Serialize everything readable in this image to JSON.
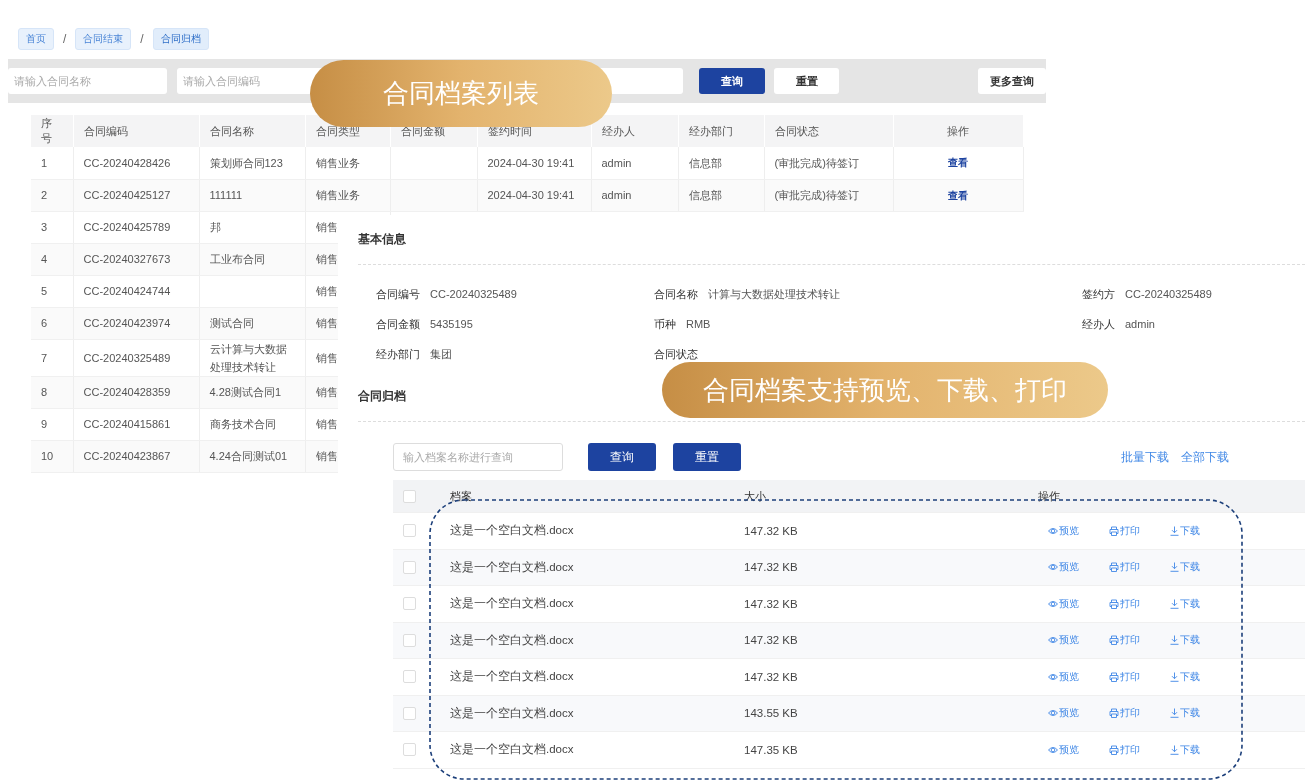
{
  "breadcrumb": [
    {
      "label": "首页",
      "selected": false
    },
    {
      "label": "合同结束",
      "selected": false
    },
    {
      "label": "合同归档",
      "selected": true
    }
  ],
  "breadcrumb_separator": "/",
  "filter": {
    "fields": [
      {
        "kind": "text",
        "placeholder": "请输入合同名称"
      },
      {
        "kind": "text",
        "placeholder": "请输入合同编码"
      },
      {
        "kind": "text"
      }
    ],
    "buttons": [
      {
        "label": "查询",
        "kind": "primary"
      },
      {
        "label": "重置",
        "kind": "default"
      },
      {
        "label": "更多查询",
        "kind": "more"
      }
    ]
  },
  "banners": [
    {
      "text": "合同档案列表"
    },
    {
      "text": "合同档案支持预览、下载、打印"
    }
  ],
  "list_table": {
    "columns": [
      "序号",
      "合同编码",
      "合同名称",
      "合同类型",
      "合同金额",
      "签约时间",
      "经办人",
      "经办部门",
      "合同状态",
      "操作"
    ],
    "rows": [
      {
        "cells": [
          "1",
          "CC-20240428426",
          "策划师合同123",
          "销售业务",
          "",
          "2024-04-30 19:41",
          "admin",
          "信息部",
          "(审批完成)待签订"
        ],
        "action": "查看"
      },
      {
        "cells": [
          "2",
          "CC-20240425127",
          "111111",
          "销售业务",
          "",
          "2024-04-30 19:41",
          "admin",
          "信息部",
          "(审批完成)待签订"
        ],
        "action": "查看"
      },
      {
        "cells": [
          "3",
          "CC-20240425789",
          "邦",
          "销售"
        ]
      },
      {
        "cells": [
          "4",
          "CC-20240327673",
          "工业布合同",
          "销售"
        ]
      },
      {
        "cells": [
          "5",
          "CC-20240424744",
          "",
          "销售"
        ]
      },
      {
        "cells": [
          "6",
          "CC-20240423974",
          "测试合同",
          "销售"
        ]
      },
      {
        "cells": [
          "7",
          "CC-20240325489",
          "云计算与大数据处理技术转让",
          "销售"
        ]
      },
      {
        "cells": [
          "8",
          "CC-20240428359",
          "4.28测试合同1",
          "销售"
        ]
      },
      {
        "cells": [
          "9",
          "CC-20240415861",
          "商务技术合同",
          "销售"
        ]
      },
      {
        "cells": [
          "10",
          "CC-20240423867",
          "4.24合同测试01",
          "销售"
        ]
      }
    ]
  },
  "detail": {
    "basic_title": "基本信息",
    "fields": [
      {
        "label": "合同编号",
        "value": "CC-20240325489"
      },
      {
        "label": "合同名称",
        "value": "计算与大数据处理技术转让"
      },
      {
        "label": "签约方",
        "value": "CC-20240325489"
      },
      {
        "label": "合同金额",
        "value": "5435195"
      },
      {
        "label": "币种",
        "value": "RMB"
      },
      {
        "label": "经办人",
        "value": "admin"
      },
      {
        "label": "经办部门",
        "value": "集团"
      },
      {
        "label": "合同状态"
      }
    ],
    "archive_title": "合同归档",
    "search": {
      "placeholder": "输入档案名称进行查询"
    },
    "buttons": [
      "查询",
      "重置"
    ],
    "links": [
      "批量下载",
      "全部下载"
    ],
    "columns": [
      "档案",
      "大小",
      "操作"
    ],
    "select_all_checked": false,
    "files": [
      {
        "name": "这是一个空白文档.docx",
        "size": "147.32 KB",
        "checked": false,
        "actions": [
          {
            "label": "预览",
            "kind": "preview"
          },
          {
            "label": "打印",
            "kind": "print"
          },
          {
            "label": "下载",
            "kind": "download"
          }
        ]
      },
      {
        "name": "这是一个空白文档.docx",
        "size": "147.32 KB",
        "checked": false,
        "actions": [
          {
            "label": "预览",
            "kind": "preview"
          },
          {
            "label": "打印",
            "kind": "print"
          },
          {
            "label": "下载",
            "kind": "download"
          }
        ]
      },
      {
        "name": "这是一个空白文档.docx",
        "size": "147.32 KB",
        "checked": false,
        "actions": [
          {
            "label": "预览",
            "kind": "preview"
          },
          {
            "label": "打印",
            "kind": "print"
          },
          {
            "label": "下载",
            "kind": "download"
          }
        ]
      },
      {
        "name": "这是一个空白文档.docx",
        "size": "147.32 KB",
        "checked": false,
        "actions": [
          {
            "label": "预览",
            "kind": "preview"
          },
          {
            "label": "打印",
            "kind": "print"
          },
          {
            "label": "下载",
            "kind": "download"
          }
        ]
      },
      {
        "name": "这是一个空白文档.docx",
        "size": "147.32 KB",
        "checked": false,
        "actions": [
          {
            "label": "预览",
            "kind": "preview"
          },
          {
            "label": "打印",
            "kind": "print"
          },
          {
            "label": "下载",
            "kind": "download"
          }
        ]
      },
      {
        "name": "这是一个空白文档.docx",
        "size": "143.55 KB",
        "checked": false,
        "actions": [
          {
            "label": "预览",
            "kind": "preview"
          },
          {
            "label": "打印",
            "kind": "print"
          },
          {
            "label": "下载",
            "kind": "download"
          }
        ]
      },
      {
        "name": "这是一个空白文档.docx",
        "size": "147.35 KB",
        "checked": false,
        "actions": [
          {
            "label": "预览",
            "kind": "preview"
          },
          {
            "label": "打印",
            "kind": "print"
          },
          {
            "label": "下载",
            "kind": "download"
          }
        ]
      }
    ]
  }
}
